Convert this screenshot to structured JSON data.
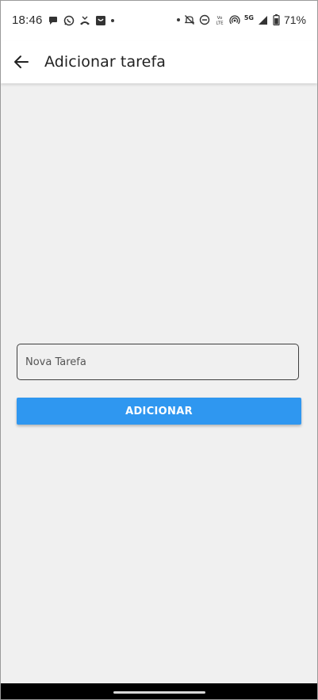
{
  "status_bar": {
    "time": "18:46",
    "network": "5G",
    "battery": "71%",
    "icons_left": [
      "chat-icon",
      "whatsapp-icon",
      "missed-call-icon",
      "shopping-bag-icon"
    ],
    "icons_right": [
      "mute-icon",
      "dnd-icon",
      "volte-icon",
      "hotspot-icon",
      "signal-icon",
      "battery-icon"
    ]
  },
  "app_bar": {
    "title": "Adicionar tarefa"
  },
  "form": {
    "task_placeholder": "Nova Tarefa",
    "task_value": "",
    "add_label": "ADICIONAR"
  },
  "colors": {
    "accent": "#2f97f0",
    "background": "#f0f0f0",
    "app_bar": "#ffffff",
    "nav_bar": "#000000"
  }
}
